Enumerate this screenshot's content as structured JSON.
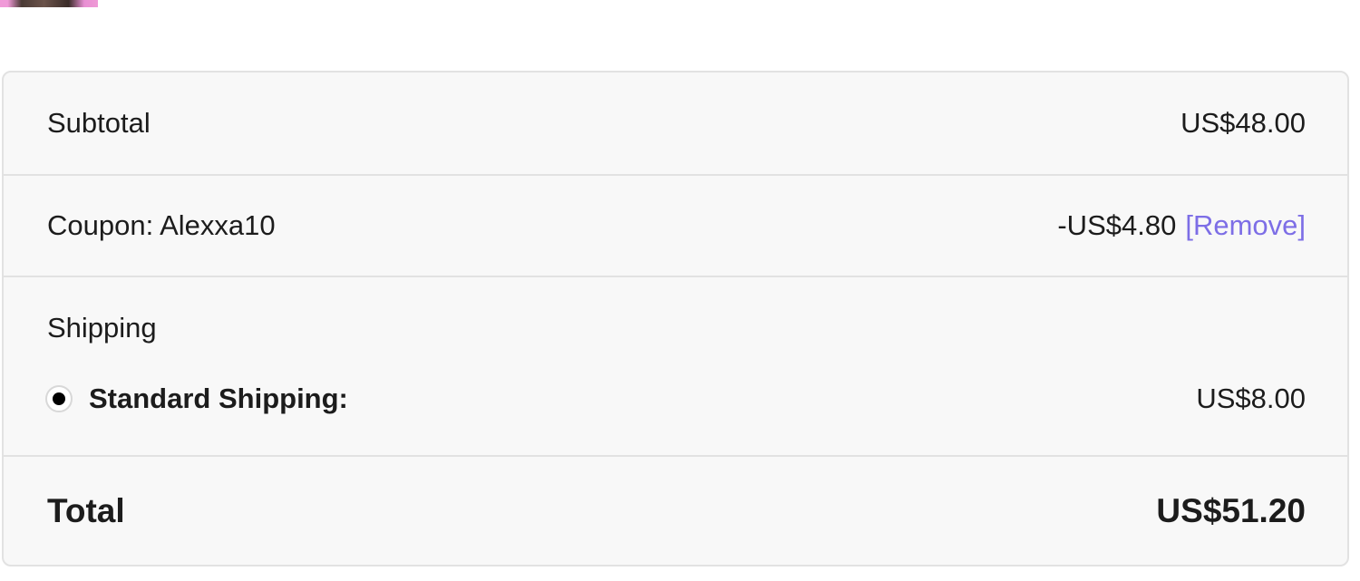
{
  "summary": {
    "subtotal": {
      "label": "Subtotal",
      "value": "US$48.00"
    },
    "coupon": {
      "label": "Coupon: Alexxa10",
      "value": "-US$4.80",
      "remove_label": "[Remove]"
    },
    "shipping": {
      "heading": "Shipping",
      "option_label": "Standard Shipping:",
      "option_value": "US$8.00",
      "option_selected": true
    },
    "total": {
      "label": "Total",
      "value": "US$51.20"
    }
  },
  "colors": {
    "link": "#7d6ee6",
    "panel_bg": "#f8f8f8",
    "border": "#e2e2e2"
  }
}
